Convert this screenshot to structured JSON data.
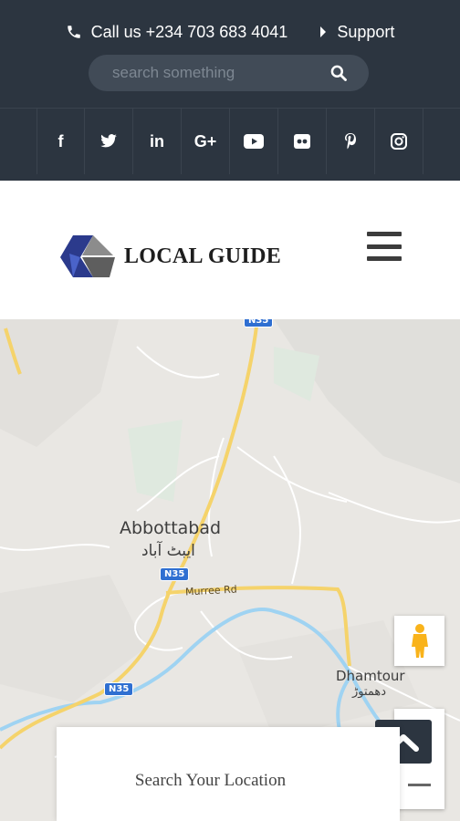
{
  "topbar": {
    "phone_text": "Call us +234 703 683 4041",
    "support_label": "Support",
    "search": {
      "placeholder": "search something",
      "value": ""
    },
    "social": [
      {
        "icon": "facebook-icon",
        "glyph": "f"
      },
      {
        "icon": "twitter-icon",
        "glyph": ""
      },
      {
        "icon": "linkedin-icon",
        "glyph": "in"
      },
      {
        "icon": "google-plus-icon",
        "glyph": "G+"
      },
      {
        "icon": "youtube-icon",
        "glyph": ""
      },
      {
        "icon": "flickr-icon",
        "glyph": ""
      },
      {
        "icon": "pinterest-icon",
        "glyph": ""
      },
      {
        "icon": "instagram-icon",
        "glyph": ""
      }
    ]
  },
  "header": {
    "logo_text": "LOCAL GUIDE"
  },
  "map": {
    "city": "Abbottabad",
    "city_urdu": "ایبٹ آباد",
    "town": "Dhamtour",
    "town_urdu": "دھمتوڑ",
    "road": "Murree Rd",
    "highway": "N35"
  },
  "search_card": {
    "title": "Search Your Location"
  },
  "colors": {
    "topbar": "#2c3540",
    "road_highway": "#f5d36b",
    "water": "#9fd3f2"
  }
}
